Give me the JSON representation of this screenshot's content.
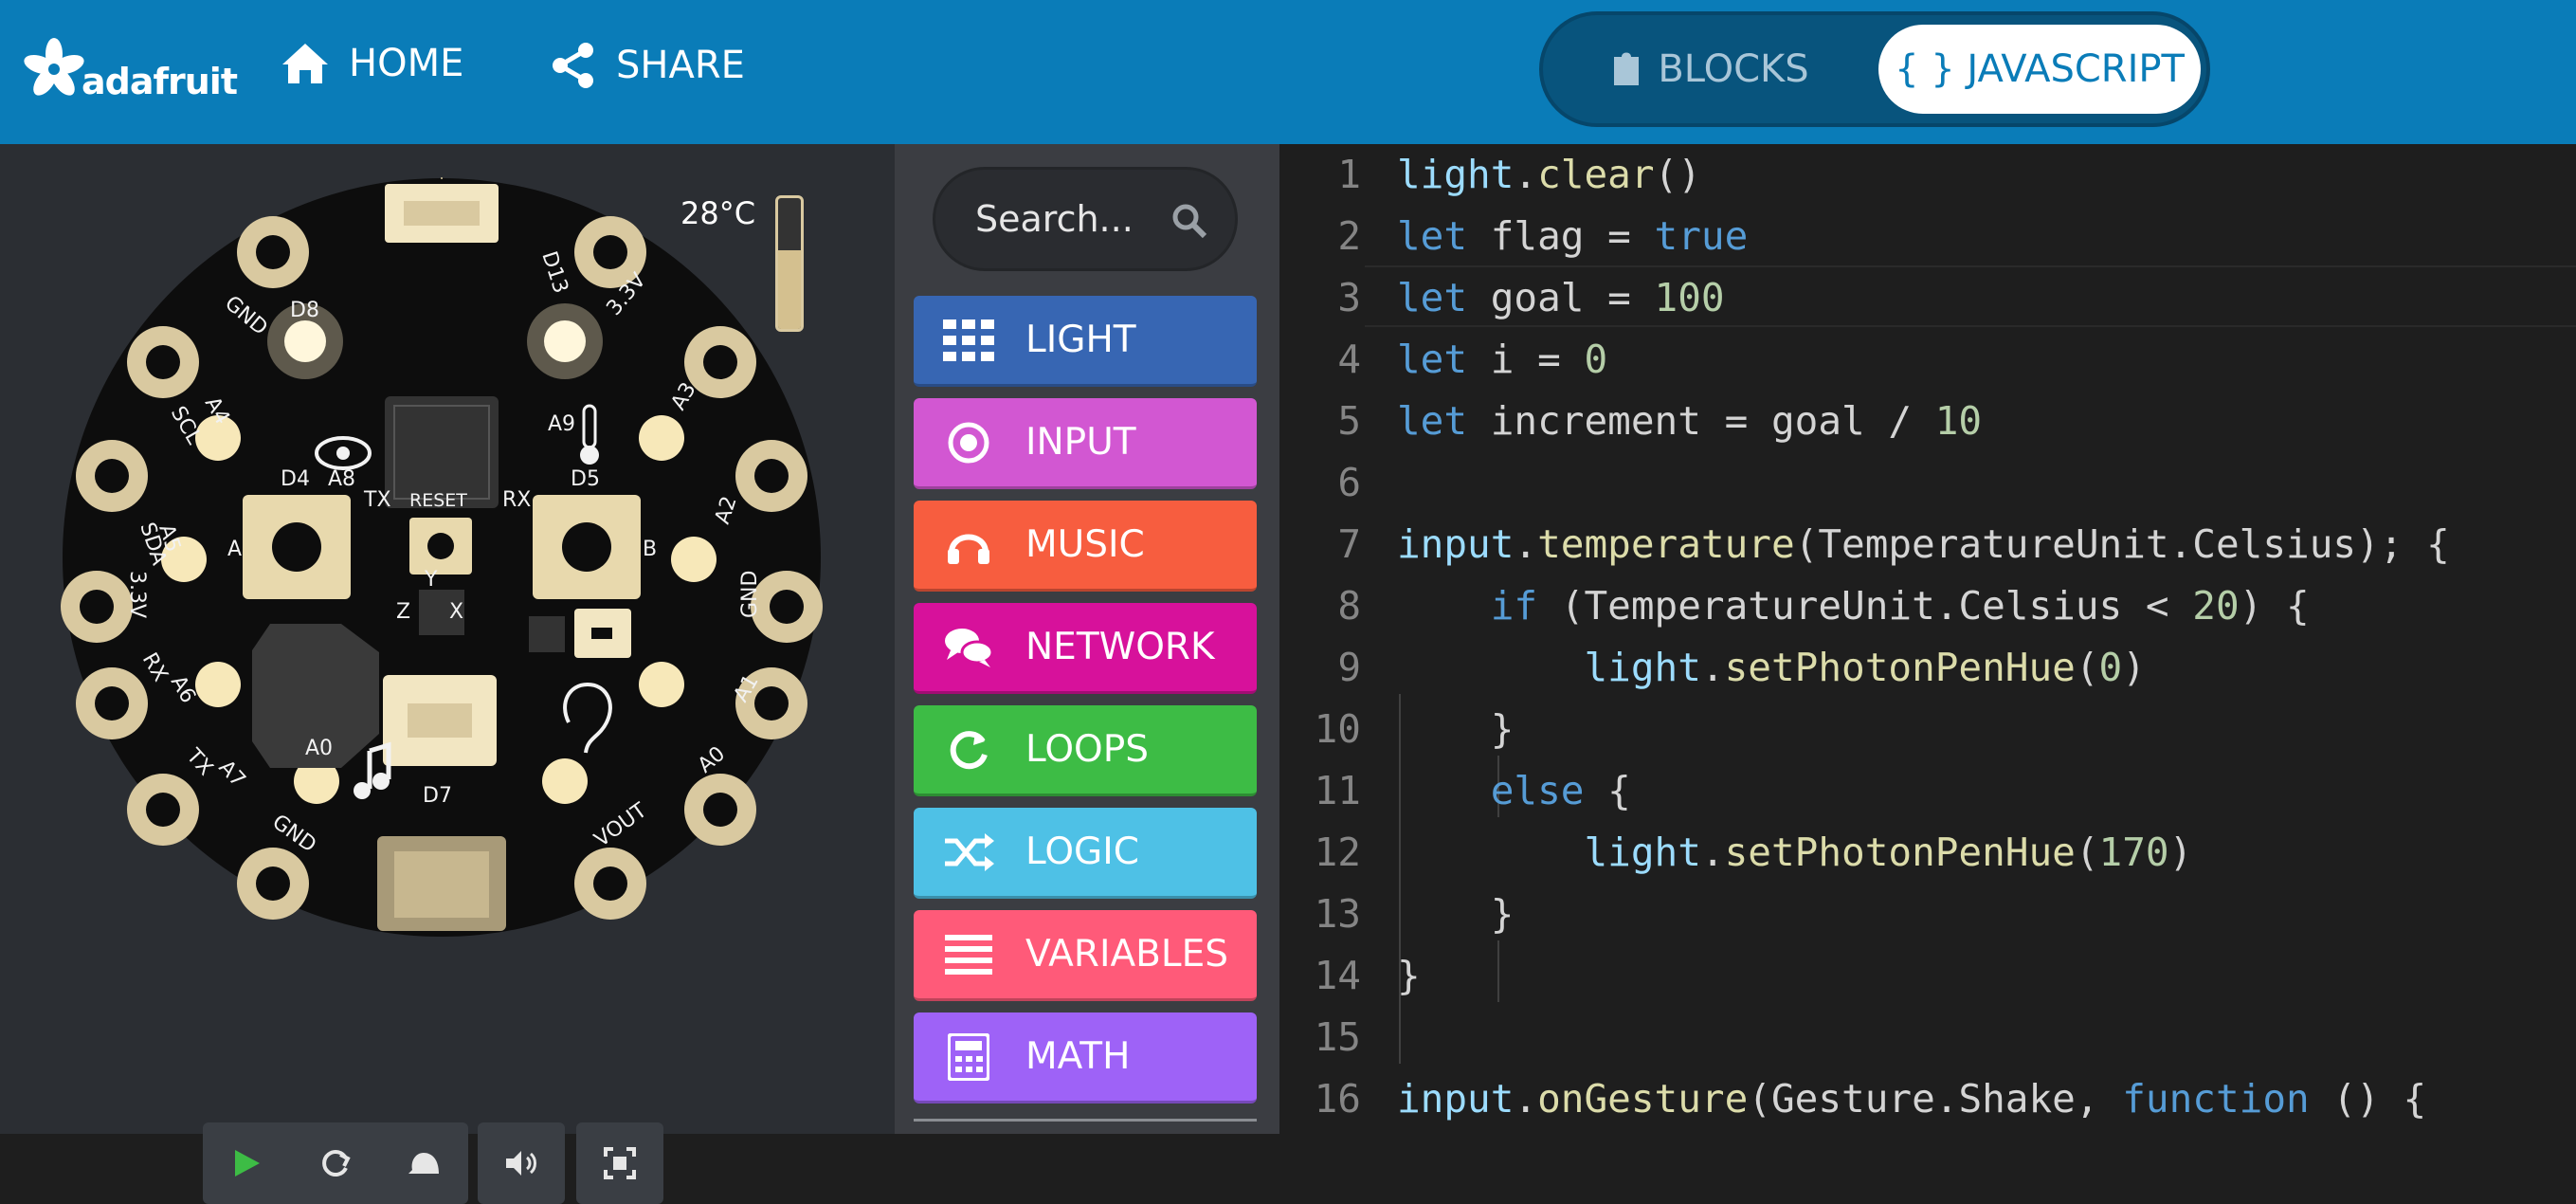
{
  "header": {
    "logo_text": "adafruit",
    "nav": [
      {
        "label": "HOME",
        "icon": "home-icon"
      },
      {
        "label": "SHARE",
        "icon": "share-icon"
      }
    ],
    "mode_toggle": {
      "blocks_label": "BLOCKS",
      "javascript_label": "{ } JAVASCRIPT",
      "active": "JAVASCRIPT"
    }
  },
  "simulator": {
    "temperature_label": "28°C",
    "temperature_level": 0.6,
    "board_labels": {
      "D13": "D13",
      "D8": "D8",
      "GND": "GND",
      "V33": "3.3V",
      "SCL": "SCL",
      "A4": "A4",
      "SDA": "SDA",
      "A5": "A5",
      "A3": "A3",
      "A2": "A2",
      "A9": "A9",
      "A8": "A8",
      "D4": "D4",
      "D5": "D5",
      "TX": "TX",
      "RX": "RX",
      "RESET": "RESET",
      "A1": "A1",
      "A6": "A6",
      "A7": "A7",
      "A0": "A0",
      "D7": "D7",
      "VOUT": "VOUT",
      "btnA": "A",
      "btnB": "B",
      "axisY": "Y",
      "axisX": "X",
      "axisZ": "Z"
    },
    "controls": [
      "play-icon",
      "restart-icon",
      "slow-mo-icon",
      "sound-icon",
      "fullscreen-icon"
    ]
  },
  "toolbox": {
    "search_placeholder": "Search...",
    "categories": [
      {
        "label": "LIGHT",
        "color": "#3766b3",
        "icon": "grid-icon"
      },
      {
        "label": "INPUT",
        "color": "#d257d2",
        "icon": "target-icon"
      },
      {
        "label": "MUSIC",
        "color": "#f75d3f",
        "icon": "headphones-icon"
      },
      {
        "label": "NETWORK",
        "color": "#d7119b",
        "icon": "chat-icon"
      },
      {
        "label": "LOOPS",
        "color": "#3dbc45",
        "icon": "refresh-icon"
      },
      {
        "label": "LOGIC",
        "color": "#4ec1e6",
        "icon": "shuffle-icon"
      },
      {
        "label": "VARIABLES",
        "color": "#ff5a79",
        "icon": "lines-icon"
      },
      {
        "label": "MATH",
        "color": "#9e62f7",
        "icon": "calculator-icon"
      }
    ]
  },
  "editor": {
    "lines": [
      {
        "num": "1",
        "text": "light.clear()"
      },
      {
        "num": "2",
        "text": "let flag = true"
      },
      {
        "num": "3",
        "text": "let goal = 100"
      },
      {
        "num": "4",
        "text": "let i = 0"
      },
      {
        "num": "5",
        "text": "let increment = goal / 10"
      },
      {
        "num": "6",
        "text": ""
      },
      {
        "num": "7",
        "text": "input.temperature(TemperatureUnit.Celsius); {"
      },
      {
        "num": "8",
        "text": "    if (TemperatureUnit.Celsius < 20) {"
      },
      {
        "num": "9",
        "text": "        light.setPhotonPenHue(0)"
      },
      {
        "num": "10",
        "text": "    }"
      },
      {
        "num": "11",
        "text": "    else {"
      },
      {
        "num": "12",
        "text": "        light.setPhotonPenHue(170)"
      },
      {
        "num": "13",
        "text": "    }"
      },
      {
        "num": "14",
        "text": "}"
      },
      {
        "num": "15",
        "text": ""
      },
      {
        "num": "16",
        "text": "input.onGesture(Gesture.Shake, function () {"
      }
    ]
  }
}
